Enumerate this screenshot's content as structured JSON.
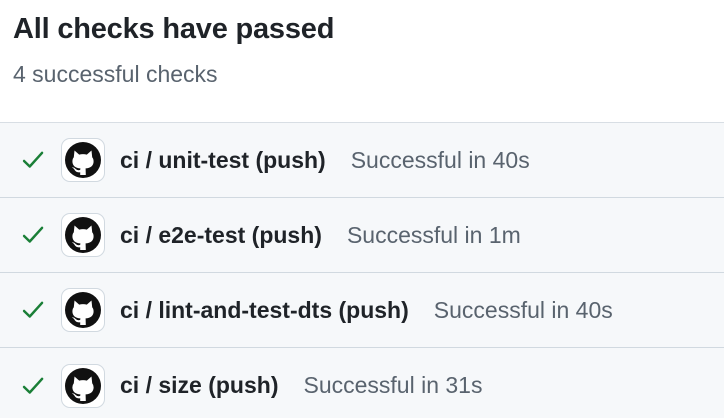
{
  "header": {
    "title": "All checks have passed",
    "subtitle": "4 successful checks"
  },
  "checks": [
    {
      "name": "ci / unit-test (push)",
      "status": "Successful in 40s",
      "state": "success",
      "icon": "check-icon"
    },
    {
      "name": "ci / e2e-test (push)",
      "status": "Successful in 1m",
      "state": "success",
      "icon": "check-icon"
    },
    {
      "name": "ci / lint-and-test-dts (push)",
      "status": "Successful in 40s",
      "state": "success",
      "icon": "check-icon"
    },
    {
      "name": "ci / size (push)",
      "status": "Successful in 31s",
      "state": "success",
      "icon": "check-icon"
    }
  ],
  "app_icon": "github-octocat-icon",
  "colors": {
    "success": "#1a7f37",
    "muted_text": "#59636e",
    "row_background": "#f6f8fa",
    "border": "#d1d9e0"
  }
}
